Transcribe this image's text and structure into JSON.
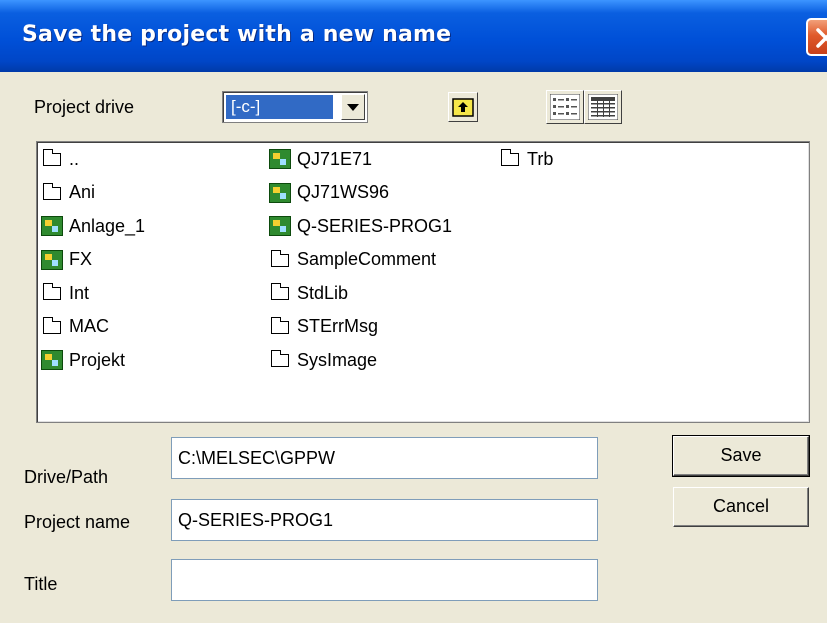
{
  "window": {
    "title": "Save the project with a new name"
  },
  "drive": {
    "label": "Project drive",
    "selected": "[-c-]"
  },
  "toolbar": {
    "up_icon": "up-folder-icon",
    "list_icon": "list-view-icon",
    "details_icon": "details-view-icon"
  },
  "files": {
    "col1": [
      {
        "name": "..",
        "type": "folder"
      },
      {
        "name": "Ani",
        "type": "folder"
      },
      {
        "name": "Anlage_1",
        "type": "project"
      },
      {
        "name": "FX",
        "type": "project"
      },
      {
        "name": "Int",
        "type": "folder"
      },
      {
        "name": "MAC",
        "type": "folder"
      },
      {
        "name": "Projekt",
        "type": "project"
      }
    ],
    "col2": [
      {
        "name": "QJ71E71",
        "type": "project"
      },
      {
        "name": "QJ71WS96",
        "type": "project"
      },
      {
        "name": "Q-SERIES-PROG1",
        "type": "project"
      },
      {
        "name": "SampleComment",
        "type": "folder"
      },
      {
        "name": "StdLib",
        "type": "folder"
      },
      {
        "name": "STErrMsg",
        "type": "folder"
      },
      {
        "name": "SysImage",
        "type": "folder"
      }
    ],
    "col3": [
      {
        "name": "Trb",
        "type": "folder"
      }
    ]
  },
  "form": {
    "path_label": "Drive/Path",
    "path_value": "C:\\MELSEC\\GPPW",
    "name_label": "Project name",
    "name_value": "Q-SERIES-PROG1",
    "title_label": "Title",
    "title_value": ""
  },
  "buttons": {
    "save": "Save",
    "cancel": "Cancel"
  },
  "colors": {
    "titlebar": "#0050d8",
    "selection": "#316ac5",
    "dialog_bg": "#ece9d8"
  }
}
